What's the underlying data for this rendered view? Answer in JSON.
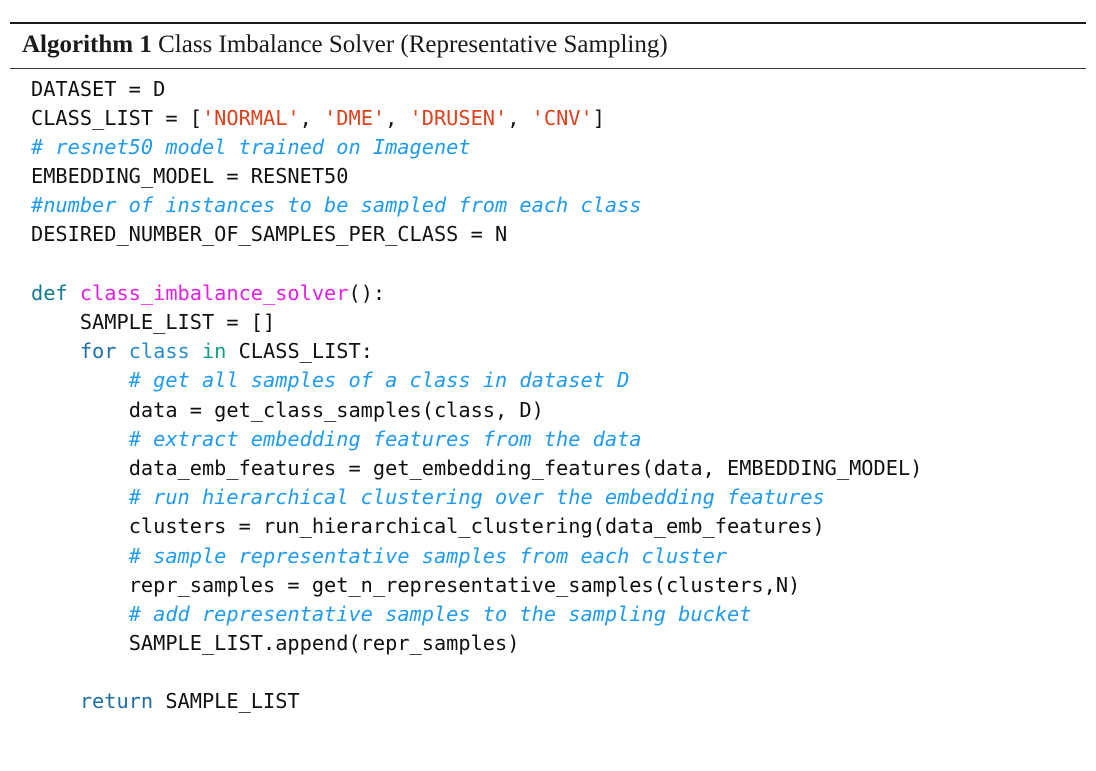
{
  "algorithm": {
    "label": "Algorithm 1",
    "title": "Class Imbalance Solver (Representative Sampling)",
    "caption_full": "Algorithm 1 Class Imbalance Solver (Representative Sampling)",
    "colors": {
      "string": "#e0411c",
      "comment": "#1f9bf0",
      "def_keyword": "#127a91",
      "function_name": "#e520e5",
      "keyword_for": "#1f6fa8",
      "keyword_class": "#2a8ec9",
      "keyword_in": "#11a085",
      "keyword_return": "#1f6fa8",
      "plain_text": "#111111",
      "rule": "#1a1a1a",
      "background": "#ffffff"
    },
    "code_lines": [
      {
        "id": "line-dataset",
        "indent": 0,
        "tokens": [
          {
            "t": "plain",
            "s": "DATASET = D"
          }
        ]
      },
      {
        "id": "line-class-list",
        "indent": 0,
        "tokens": [
          {
            "t": "plain",
            "s": "CLASS_LIST = ["
          },
          {
            "t": "string",
            "s": "'NORMAL'"
          },
          {
            "t": "plain",
            "s": ", "
          },
          {
            "t": "string",
            "s": "'DME'"
          },
          {
            "t": "plain",
            "s": ", "
          },
          {
            "t": "string",
            "s": "'DRUSEN'"
          },
          {
            "t": "plain",
            "s": ", "
          },
          {
            "t": "string",
            "s": "'CNV'"
          },
          {
            "t": "plain",
            "s": "]"
          }
        ]
      },
      {
        "id": "line-comment-resnet",
        "indent": 0,
        "tokens": [
          {
            "t": "comment",
            "s": "# resnet50 model trained on Imagenet"
          }
        ]
      },
      {
        "id": "line-embedding-model",
        "indent": 0,
        "tokens": [
          {
            "t": "plain",
            "s": "EMBEDDING_MODEL = RESNET50"
          }
        ]
      },
      {
        "id": "line-comment-number",
        "indent": 0,
        "tokens": [
          {
            "t": "comment",
            "s": "#number of instances to be sampled from each class"
          }
        ]
      },
      {
        "id": "line-desired-number",
        "indent": 0,
        "tokens": [
          {
            "t": "plain",
            "s": "DESIRED_NUMBER_OF_SAMPLES_PER_CLASS = N"
          }
        ]
      },
      {
        "id": "line-blank-1",
        "indent": 0,
        "tokens": []
      },
      {
        "id": "line-def",
        "indent": 0,
        "tokens": [
          {
            "t": "def",
            "s": "def "
          },
          {
            "t": "fname",
            "s": "class_imbalance_solver"
          },
          {
            "t": "plain",
            "s": "():"
          }
        ]
      },
      {
        "id": "line-sample-list",
        "indent": 1,
        "tokens": [
          {
            "t": "plain",
            "s": "SAMPLE_LIST = []"
          }
        ]
      },
      {
        "id": "line-for",
        "indent": 1,
        "tokens": [
          {
            "t": "kw-for",
            "s": "for "
          },
          {
            "t": "kw-class",
            "s": "class"
          },
          {
            "t": "plain",
            "s": " "
          },
          {
            "t": "kw-in",
            "s": "in"
          },
          {
            "t": "plain",
            "s": " CLASS_LIST:"
          }
        ]
      },
      {
        "id": "line-comment-getall",
        "indent": 2,
        "tokens": [
          {
            "t": "comment",
            "s": "# get all samples of a class in dataset D"
          }
        ]
      },
      {
        "id": "line-data",
        "indent": 2,
        "tokens": [
          {
            "t": "plain",
            "s": "data = get_class_samples(class, D)"
          }
        ]
      },
      {
        "id": "line-comment-extract",
        "indent": 2,
        "tokens": [
          {
            "t": "comment",
            "s": "# extract embedding features from the data"
          }
        ]
      },
      {
        "id": "line-data-emb",
        "indent": 2,
        "tokens": [
          {
            "t": "plain",
            "s": "data_emb_features = get_embedding_features(data, EMBEDDING_MODEL)"
          }
        ]
      },
      {
        "id": "line-comment-run",
        "indent": 2,
        "tokens": [
          {
            "t": "comment",
            "s": "# run hierarchical clustering over the embedding features"
          }
        ]
      },
      {
        "id": "line-clusters",
        "indent": 2,
        "tokens": [
          {
            "t": "plain",
            "s": "clusters = run_hierarchical_clustering(data_emb_features)"
          }
        ]
      },
      {
        "id": "line-comment-sample",
        "indent": 2,
        "tokens": [
          {
            "t": "comment",
            "s": "# sample representative samples from each cluster"
          }
        ]
      },
      {
        "id": "line-repr-samples",
        "indent": 2,
        "tokens": [
          {
            "t": "plain",
            "s": "repr_samples = get_n_representative_samples(clusters,N)"
          }
        ]
      },
      {
        "id": "line-comment-add",
        "indent": 2,
        "tokens": [
          {
            "t": "comment",
            "s": "# add representative samples to the sampling bucket"
          }
        ]
      },
      {
        "id": "line-append",
        "indent": 2,
        "tokens": [
          {
            "t": "plain",
            "s": "SAMPLE_LIST.append(repr_samples)"
          }
        ]
      },
      {
        "id": "line-blank-2",
        "indent": 0,
        "tokens": []
      },
      {
        "id": "line-return",
        "indent": 1,
        "tokens": [
          {
            "t": "return",
            "s": "return"
          },
          {
            "t": "plain",
            "s": " SAMPLE_LIST"
          }
        ]
      }
    ]
  }
}
